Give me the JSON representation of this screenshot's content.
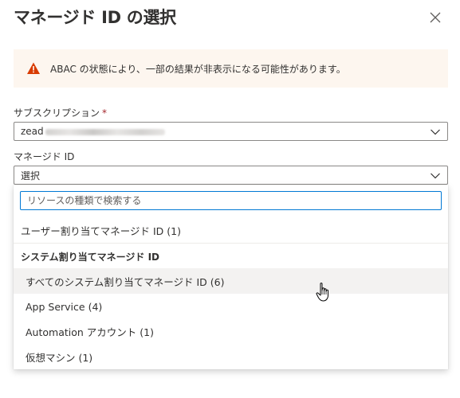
{
  "header": {
    "title": "マネージド ID の選択",
    "close_icon": "close-icon"
  },
  "warning": {
    "icon": "warning-icon",
    "text": "ABAC の状態により、一部の結果が非表示になる可能性があります。",
    "color": "#d83b01",
    "background": "#fdf6ef"
  },
  "subscription": {
    "label": "サブスクリプション",
    "required_mark": "*",
    "value": "zead"
  },
  "managed_id": {
    "label": "マネージド ID",
    "value": "選択"
  },
  "dropdown": {
    "search_placeholder": "リソースの種類で検索する",
    "options": [
      {
        "label": "ユーザー割り当てマネージド ID (1)"
      },
      {
        "label": "システム割り当てマネージド ID"
      },
      {
        "label": "すべてのシステム割り当てマネージド ID (6)"
      },
      {
        "label": "App Service (4)"
      },
      {
        "label": "Automation アカウント (1)"
      },
      {
        "label": "仮想マシン (1)"
      }
    ]
  },
  "colors": {
    "accent": "#0078d4",
    "required": "#a4262c",
    "hover_bg": "#f3f2f1"
  }
}
